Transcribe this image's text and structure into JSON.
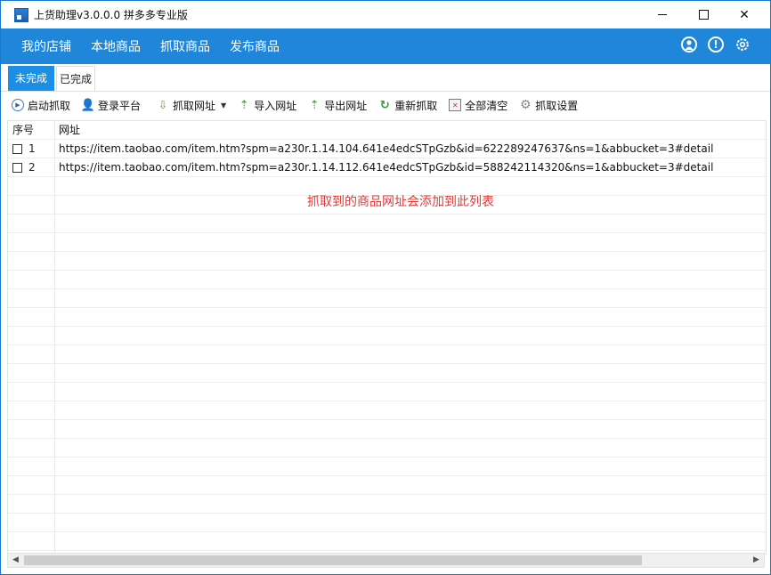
{
  "window": {
    "title": "上货助理v3.0.0.0 拼多多专业版",
    "controls": {
      "minimize": "─",
      "maximize": "□",
      "close": "✕"
    }
  },
  "nav": {
    "items": [
      "我的店铺",
      "本地商品",
      "抓取商品",
      "发布商品"
    ],
    "icons": [
      "user-icon",
      "info-icon",
      "gear-icon"
    ]
  },
  "tabs": [
    {
      "label": "未完成",
      "active": true
    },
    {
      "label": "已完成",
      "active": false
    }
  ],
  "toolbar": {
    "buttons": [
      {
        "label": "启动抓取",
        "icon": "play-icon"
      },
      {
        "label": "登录平台",
        "icon": "user-icon"
      },
      {
        "label": "抓取网址",
        "icon": "grab-icon",
        "has_dropdown": true
      },
      {
        "label": "导入网址",
        "icon": "import-icon"
      },
      {
        "label": "导出网址",
        "icon": "export-icon"
      },
      {
        "label": "重新抓取",
        "icon": "refresh-icon"
      },
      {
        "label": "全部清空",
        "icon": "clear-icon"
      },
      {
        "label": "抓取设置",
        "icon": "settings-icon"
      }
    ]
  },
  "grid": {
    "headers": {
      "seq": "序号",
      "url": "网址"
    },
    "rows": [
      {
        "seq": "1",
        "url": "https://item.taobao.com/item.htm?spm=a230r.1.14.104.641e4edcSTpGzb&id=622289247637&ns=1&abbucket=3#detail",
        "checked": false
      },
      {
        "seq": "2",
        "url": "https://item.taobao.com/item.htm?spm=a230r.1.14.112.641e4edcSTpGzb&id=588242114320&ns=1&abbucket=3#detail",
        "checked": false
      }
    ],
    "hint": "抓取到的商品网址会添加到此列表"
  },
  "colors": {
    "accent": "#1f86d9",
    "tab_active": "#1b8ee5",
    "hint": "#e53935"
  }
}
